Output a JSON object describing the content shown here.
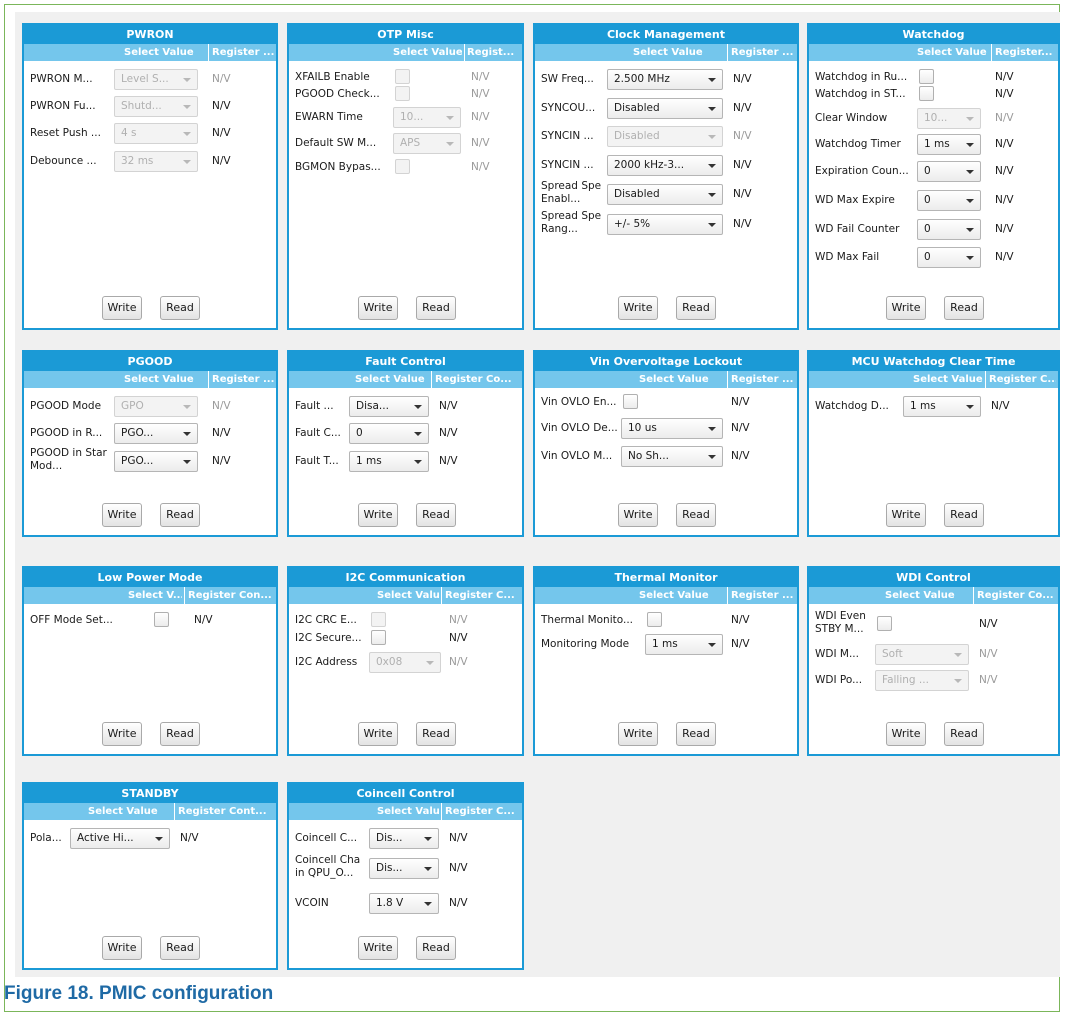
{
  "colors": {
    "panel_border": "#1b9ad6",
    "title_bg": "#1b9ad6",
    "header_bg": "#74c6ec",
    "caption": "#1f6aa5"
  },
  "caption": "Figure 18.  PMIC configuration",
  "panels": {
    "pwron": {
      "title": "PWRON",
      "hdr_value": "Select Value",
      "hdr_register": "Register ...",
      "rows": [
        {
          "label": "PWRON M...",
          "value": "Level S...",
          "register": "N/V"
        },
        {
          "label": "PWRON Fu...",
          "value": "Shutd...",
          "register": "N/V"
        },
        {
          "label": "Reset Push ...",
          "value": "4 s",
          "register": "N/V"
        },
        {
          "label": "Debounce ...",
          "value": "32 ms",
          "register": "N/V"
        }
      ],
      "write": "Write",
      "read": "Read"
    },
    "otp": {
      "title": "OTP Misc",
      "hdr_value": "Select Value",
      "hdr_register": "Regist...",
      "rows": [
        {
          "label": "XFAILB Enable",
          "register": "N/V"
        },
        {
          "label": "PGOOD Check...",
          "register": "N/V"
        },
        {
          "label": "EWARN Time",
          "value": "10...",
          "register": "N/V"
        },
        {
          "label": "Default SW M...",
          "value": "APS",
          "register": "N/V"
        },
        {
          "label": "BGMON Bypas...",
          "register": "N/V"
        }
      ],
      "write": "Write",
      "read": "Read"
    },
    "clock": {
      "title": "Clock Management",
      "hdr_value": "Select Value",
      "hdr_register": "Register ...",
      "rows": [
        {
          "label": "SW Freq...",
          "value": "2.500 MHz",
          "register": "N/V"
        },
        {
          "label": "SYNCOU...",
          "value": "Disabled",
          "register": "N/V"
        },
        {
          "label": "SYNCIN ...",
          "value": "Disabled",
          "register": "N/V"
        },
        {
          "label": "SYNCIN ...",
          "value": "2000 kHz-3...",
          "register": "N/V"
        },
        {
          "label": "Spread Spe\nEnabl...",
          "value": "Disabled",
          "register": "N/V"
        },
        {
          "label": "Spread Spe\nRang...",
          "value": "+/- 5%",
          "register": "N/V"
        }
      ],
      "write": "Write",
      "read": "Read"
    },
    "watchdog": {
      "title": "Watchdog",
      "hdr_value": "Select Value",
      "hdr_register": "Register...",
      "rows": [
        {
          "label": "Watchdog in Ru...",
          "register": "N/V"
        },
        {
          "label": "Watchdog in ST...",
          "register": "N/V"
        },
        {
          "label": "Clear Window",
          "value": "10...",
          "register": "N/V"
        },
        {
          "label": "Watchdog Timer",
          "value": "1 ms",
          "register": "N/V"
        },
        {
          "label": "Expiration Coun...",
          "value": "0",
          "register": "N/V"
        },
        {
          "label": "WD Max Expire",
          "value": "0",
          "register": "N/V"
        },
        {
          "label": "WD Fail Counter",
          "value": "0",
          "register": "N/V"
        },
        {
          "label": "WD Max Fail",
          "value": "0",
          "register": "N/V"
        }
      ],
      "write": "Write",
      "read": "Read"
    },
    "pgood": {
      "title": "PGOOD",
      "hdr_value": "Select Value",
      "hdr_register": "Register ...",
      "rows": [
        {
          "label": "PGOOD Mode",
          "value": "GPO",
          "register": "N/V"
        },
        {
          "label": "PGOOD in R...",
          "value": "PGO...",
          "register": "N/V"
        },
        {
          "label": "PGOOD in Star\nMod...",
          "value": "PGO...",
          "register": "N/V"
        }
      ],
      "write": "Write",
      "read": "Read"
    },
    "fault": {
      "title": "Fault Control",
      "hdr_value": "Select Value",
      "hdr_register": "Register Co...",
      "rows": [
        {
          "label": "Fault ...",
          "value": "Disa...",
          "register": "N/V"
        },
        {
          "label": "Fault C...",
          "value": "0",
          "register": "N/V"
        },
        {
          "label": "Fault T...",
          "value": "1 ms",
          "register": "N/V"
        }
      ],
      "write": "Write",
      "read": "Read"
    },
    "vin": {
      "title": "Vin Overvoltage Lockout",
      "hdr_value": "Select Value",
      "hdr_register": "Register ...",
      "rows": [
        {
          "label": "Vin OVLO En...",
          "register": "N/V"
        },
        {
          "label": "Vin OVLO De...",
          "value": "10 us",
          "register": "N/V"
        },
        {
          "label": "Vin OVLO M...",
          "value": "No Sh...",
          "register": "N/V"
        }
      ],
      "write": "Write",
      "read": "Read"
    },
    "mcu": {
      "title": "MCU Watchdog Clear Time",
      "hdr_value": "Select Value",
      "hdr_register": "Register C...",
      "rows": [
        {
          "label": "Watchdog D...",
          "value": "1 ms",
          "register": "N/V"
        }
      ],
      "write": "Write",
      "read": "Read"
    },
    "lowpower": {
      "title": "Low Power Mode",
      "hdr_value": "Select V...",
      "hdr_register": "Register Con...",
      "rows": [
        {
          "label": "OFF Mode Set...",
          "register": "N/V"
        }
      ],
      "write": "Write",
      "read": "Read"
    },
    "i2c": {
      "title": "I2C Communication",
      "hdr_value": "Select Value",
      "hdr_register": "Register C...",
      "rows": [
        {
          "label": "I2C CRC E...",
          "register": "N/V"
        },
        {
          "label": "I2C Secure...",
          "register": "N/V"
        },
        {
          "label": "I2C Address",
          "value": "0x08",
          "register": "N/V"
        }
      ],
      "write": "Write",
      "read": "Read"
    },
    "thermal": {
      "title": "Thermal Monitor",
      "hdr_value": "Select Value",
      "hdr_register": "Register ...",
      "rows": [
        {
          "label": "Thermal Monito...",
          "register": "N/V"
        },
        {
          "label": "Monitoring Mode",
          "value": "1 ms",
          "register": "N/V"
        }
      ],
      "write": "Write",
      "read": "Read"
    },
    "wdi": {
      "title": "WDI Control",
      "hdr_value": "Select Value",
      "hdr_register": "Register Co...",
      "rows": [
        {
          "label": "WDI Even\nSTBY M...",
          "register": "N/V"
        },
        {
          "label": "WDI M...",
          "value": "Soft",
          "register": "N/V"
        },
        {
          "label": "WDI Po...",
          "value": "Falling ...",
          "register": "N/V"
        }
      ],
      "write": "Write",
      "read": "Read"
    },
    "standby": {
      "title": "STANDBY",
      "hdr_value": "Select Value",
      "hdr_register": "Register Cont...",
      "rows": [
        {
          "label": "Pola...",
          "value": "Active Hi...",
          "register": "N/V"
        }
      ],
      "write": "Write",
      "read": "Read"
    },
    "coincell": {
      "title": "Coincell Control",
      "hdr_value": "Select Value",
      "hdr_register": "Register C...",
      "rows": [
        {
          "label": "Coincell C...",
          "value": "Dis...",
          "register": "N/V"
        },
        {
          "label": "Coincell Cha\nin QPU_O...",
          "value": "Dis...",
          "register": "N/V"
        },
        {
          "label": "VCOIN",
          "value": "1.8 V",
          "register": "N/V"
        }
      ],
      "write": "Write",
      "read": "Read"
    }
  }
}
